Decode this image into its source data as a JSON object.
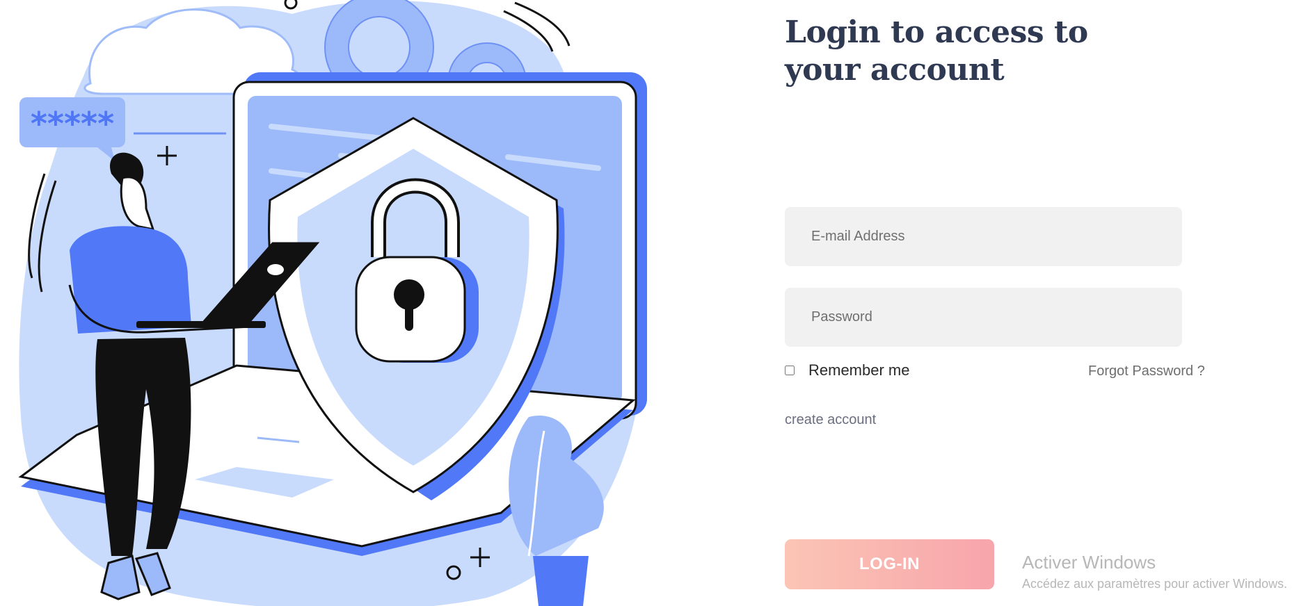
{
  "page": {
    "title_line1": "Login to access to",
    "title_line2": "your account"
  },
  "illustration": {
    "bubble_text": "*****",
    "subject": "security-lock-shield-laptop"
  },
  "form": {
    "email": {
      "placeholder": "E-mail Address",
      "value": ""
    },
    "password": {
      "placeholder": "Password",
      "value": ""
    },
    "remember_label": "Remember me",
    "remember_checked": false,
    "forgot_label": "Forgot Password ?",
    "create_label": "create account",
    "login_label": "LOG-IN"
  },
  "watermark": {
    "title": "Activer Windows",
    "subtitle": "Accédez aux paramètres pour activer Windows."
  },
  "colors": {
    "accent_blue": "#5179f7",
    "light_blue": "#c9dbfd",
    "title_color": "#2f3a52",
    "button_gradient_start": "#fbc5b5",
    "button_gradient_end": "#f7a5ab",
    "field_bg": "#f1f1f1"
  }
}
